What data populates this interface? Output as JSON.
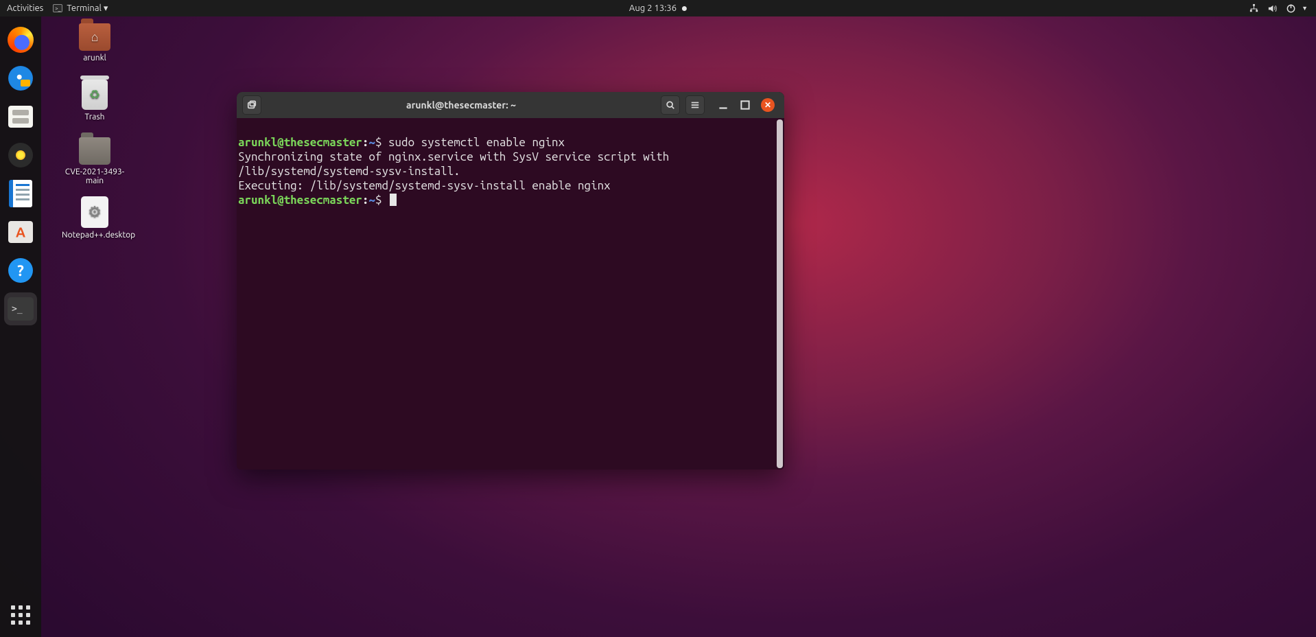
{
  "topbar": {
    "activities": "Activities",
    "app_menu": "Terminal ▾",
    "clock": "Aug 2  13:36"
  },
  "desktop_icons": {
    "home": "arunkl",
    "trash": "Trash",
    "cve": "CVE-2021-3493-main",
    "npp": "Notepad++.desktop"
  },
  "dock": {
    "apps": [
      "firefox",
      "thunderbird",
      "files",
      "rhythmbox",
      "writer",
      "software",
      "help",
      "terminal"
    ]
  },
  "terminal": {
    "title": "arunkl@thesecmaster: ~",
    "prompt": {
      "user_host": "arunkl@thesecmaster",
      "path": "~",
      "symbol": "$"
    },
    "lines": {
      "cmd1": "sudo systemctl enable nginx",
      "out1": "Synchronizing state of nginx.service with SysV service script with /lib/systemd/systemd-sysv-install.",
      "out2": "Executing: /lib/systemd/systemd-sysv-install enable nginx"
    }
  }
}
